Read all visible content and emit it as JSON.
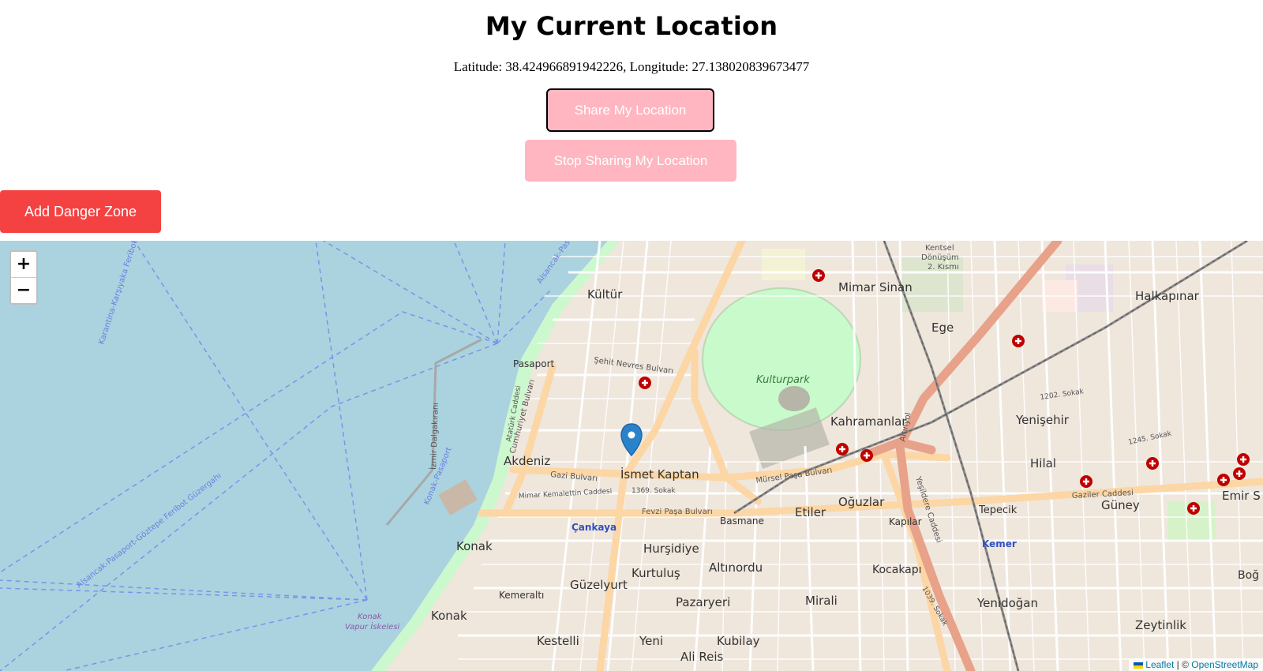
{
  "header": {
    "title": "My Current Location",
    "coordinates": "Latitude: 38.424966891942226, Longitude: 27.138020839673477"
  },
  "buttons": {
    "share": "Share My Location",
    "stop": "Stop Sharing My Location",
    "danger": "Add Danger Zone"
  },
  "colors": {
    "share_button_bg": "#ffb6c1",
    "danger_button_bg": "#f44242",
    "sea": "#aad3df",
    "park": "#c8facc",
    "urban": "#f2efe9"
  },
  "map": {
    "zoom_in": "+",
    "zoom_out": "−",
    "marker_icon": "map-pin-icon",
    "attribution": {
      "leaflet": "Leaflet",
      "separator": " | © ",
      "osm": "OpenStreetMap"
    },
    "labels": {
      "kultur": "Kültür",
      "mimar_sinan": "Mimar Sinan",
      "halkapinar": "Halkapınar",
      "ege": "Ege",
      "pasaport": "Pasaport",
      "kulturpark": "Kulturpark",
      "kahramanlar": "Kahramanlar",
      "yenisehir": "Yenişehir",
      "hilal": "Hilal",
      "akdeniz": "Akdeniz",
      "ismet_kaptan": "İsmet Kaptan",
      "oguzlar": "Oğuzlar",
      "etiler": "Etiler",
      "basmane": "Basmane",
      "kapilar": "Kapılar",
      "tepecik": "Tepecik",
      "guney": "Güney",
      "emir_sultan": "Emir S",
      "cankaya": "Çankaya",
      "konak_top": "Konak",
      "hursidiye": "Hurşidiye",
      "kurtulus": "Kurtuluş",
      "altinordu": "Altınordu",
      "kocakapi": "Kocakapı",
      "kemer": "Kemer",
      "guzelyurt": "Güzelyurt",
      "kemeralti": "Kemeraltı",
      "mirali": "Mirali",
      "yenidogan": "Yenidoğan",
      "pazaryeri": "Pazaryeri",
      "konak_bottom": "Konak",
      "zeytinlik": "Zeytinlik",
      "kestelli": "Kestelli",
      "yeni": "Yeni",
      "kubilay": "Kubilay",
      "ali_reis": "Ali Reis",
      "konak_vapur_1": "Konak",
      "konak_vapur_2": "Vapur İskelesi",
      "izmir_dalgakirani": "İzmir Dalgakıranı",
      "konak_pasaport": "Konak-Pasaport",
      "ferry_1": "Karantina-Karşıyaka Feribot",
      "ferry_2": "Alsancak-Pasaport-Göztepe Feribot Güzergahı",
      "alsancak_pas": "Alsancak-Pas",
      "kentsel": "Kentsel",
      "donusum": "Dönüşüm",
      "kismi": "2. Kısmı",
      "sehit_nevres": "Şehit Nevres Bulvarı",
      "gazi_bulvari": "Gazi Bulvarı",
      "mursel_pasa": "Mürsel Paşa Bulvarı",
      "fevzi_pasa": "Fevzi Paşa Bulvarı",
      "gaziler": "Gaziler Caddesi",
      "mimar_kemalettin": "Mimar Kemalettin Caddesi",
      "cumhuriyet": "Cumhuriyet Bulvarı",
      "ataturk": "Atatürk Caddesi",
      "yesildere": "Yeşildere Caddesi",
      "altinyol": "Altınyol",
      "sokak_1369": "1369. Sokak",
      "sokak_1202": "1202. Sokak",
      "sokak_1245": "1245. Sokak",
      "sokak_1039": "1039. Sokak",
      "bogaz": "Boğ"
    }
  }
}
